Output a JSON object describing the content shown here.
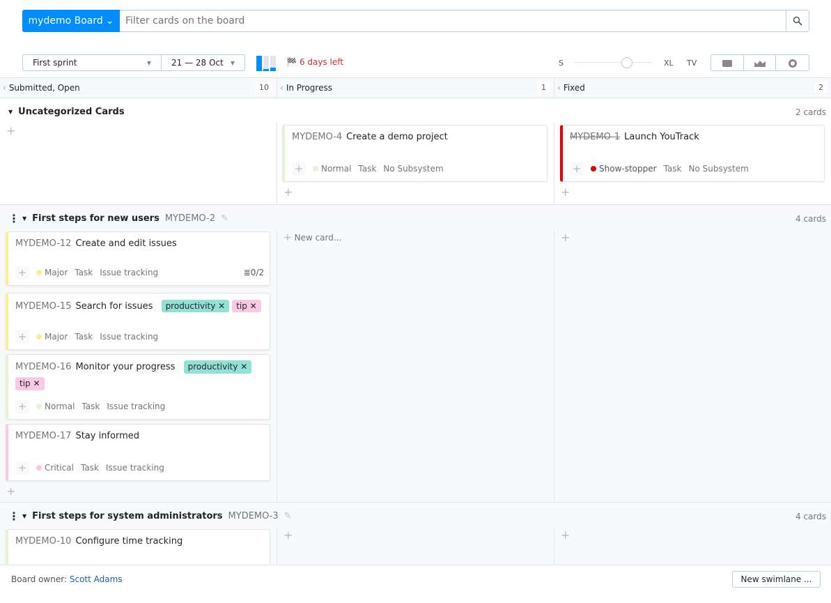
{
  "header": {
    "board_button": "mydemo Board",
    "search_placeholder": "Filter cards on the board"
  },
  "toolbar": {
    "sprint": "First sprint",
    "dates": "21 — 28 Oct",
    "days_left": "6 days left",
    "size_s": "S",
    "size_xl": "XL",
    "size_tv": "TV",
    "card_size_percent": 70
  },
  "columns": [
    {
      "title": "Submitted, Open",
      "count": "10"
    },
    {
      "title": "In Progress",
      "count": "1"
    },
    {
      "title": "Fixed",
      "count": "2"
    }
  ],
  "lanes": [
    {
      "title": "Uncategorized Cards",
      "count": "2 cards"
    },
    {
      "title": "First steps for new users",
      "id": "MYDEMO-2",
      "count": "4 cards",
      "new_card": "New card..."
    },
    {
      "title": "First steps for system administrators",
      "id": "MYDEMO-3",
      "count": "4 cards"
    }
  ],
  "cards": {
    "c4": {
      "id": "MYDEMO-4",
      "summary": "Create a demo project",
      "priority": "Normal",
      "type": "Task",
      "subsystem": "No Subsystem"
    },
    "c1": {
      "id": "MYDEMO-1",
      "summary": "Launch YouTrack",
      "priority": "Show-stopper",
      "type": "Task",
      "subsystem": "No Subsystem"
    },
    "c12": {
      "id": "MYDEMO-12",
      "summary": "Create and edit issues",
      "priority": "Major",
      "type": "Task",
      "subsystem": "Issue tracking",
      "checklist": "0/2"
    },
    "c15": {
      "id": "MYDEMO-15",
      "summary": "Search for issues",
      "tags": [
        "productivity",
        "tip"
      ],
      "priority": "Major",
      "type": "Task",
      "subsystem": "Issue tracking"
    },
    "c16": {
      "id": "MYDEMO-16",
      "summary": "Monitor your progress",
      "tags": [
        "productivity",
        "tip"
      ],
      "priority": "Normal",
      "type": "Task",
      "subsystem": "Issue tracking"
    },
    "c17": {
      "id": "MYDEMO-17",
      "summary": "Stay informed",
      "priority": "Critical",
      "type": "Task",
      "subsystem": "Issue tracking"
    },
    "c10": {
      "id": "MYDEMO-10",
      "summary": "Configure time tracking"
    }
  },
  "footer": {
    "owner_label": "Board owner:",
    "owner": "Scott Adams",
    "new_swimlane": "New swimlane ..."
  },
  "colors": {
    "accent": "#008eff",
    "normal": "#e3f3d4",
    "major": "#fbec96",
    "critical": "#fbc8e6",
    "showstopper": "#e30000",
    "tag_productivity": "#92e1d5",
    "tag_tip": "#fbc8e6"
  }
}
